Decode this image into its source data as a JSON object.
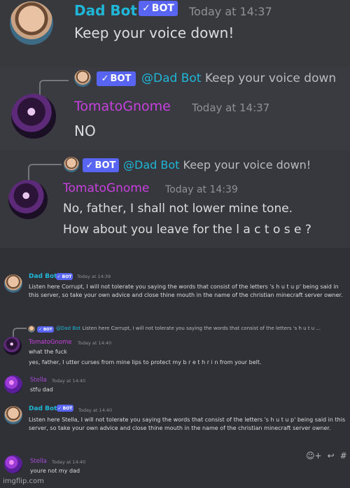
{
  "messages": [
    {
      "author": "Dad Bot",
      "bot": "BOT",
      "time": "Today at 14:37",
      "text": "Keep your voice down!"
    },
    {
      "reply": {
        "mention": "@Dad Bot",
        "text": "Keep your voice down"
      },
      "author": "TomatoGnome",
      "time": "Today at 14:37",
      "text": "NO"
    },
    {
      "reply": {
        "mention": "@Dad Bot",
        "text": "Keep your voice down!"
      },
      "author": "TomatoGnome",
      "time": "Today at 14:39",
      "lines": [
        "No, father, I shall not lower mine tone.",
        "How about you leave for the l a c t o s e ?"
      ]
    },
    {
      "author": "Dad Bot",
      "bot": "BOT",
      "time": "Today at 14:39",
      "text": "Listen here Corrupt, I will not tolerate you saying the words that consist of the letters 's h u t  u p' being said in this server, so take your own advice and close thine mouth in the name of the christian minecraft server owner."
    },
    {
      "reply": {
        "mention": "@Dad Bot",
        "text": "Listen here Corrupt, I will not tolerate you saying the words that consist of the letters 's h u t  u ..."
      },
      "author": "TomatoGnome",
      "time": "Today at 14:40",
      "lines": [
        "what the fuck",
        "yes, father, I utter curses from mine lips to protect my b r e t h r i n from your belt."
      ]
    },
    {
      "author": "Stella",
      "time": "Today at 14:40",
      "text": "stfu dad"
    },
    {
      "author": "Dad Bot",
      "bot": "BOT",
      "time": "Today at 14:40",
      "text": "Listen here Stella, I will not tolerate you saying the words that consist of the letters 's h u t  u p' being said in this server, so take your own advice and close thine mouth in the name of the christian minecraft server owner."
    },
    {
      "author": "Stella",
      "time": "Today at 14:40",
      "text": "youre not my dad"
    }
  ],
  "actions": {
    "reaction_icon": "add-reaction-icon",
    "reply_icon": "reply-icon",
    "thread_icon": "thread-icon"
  },
  "watermark": "imgflip.com"
}
